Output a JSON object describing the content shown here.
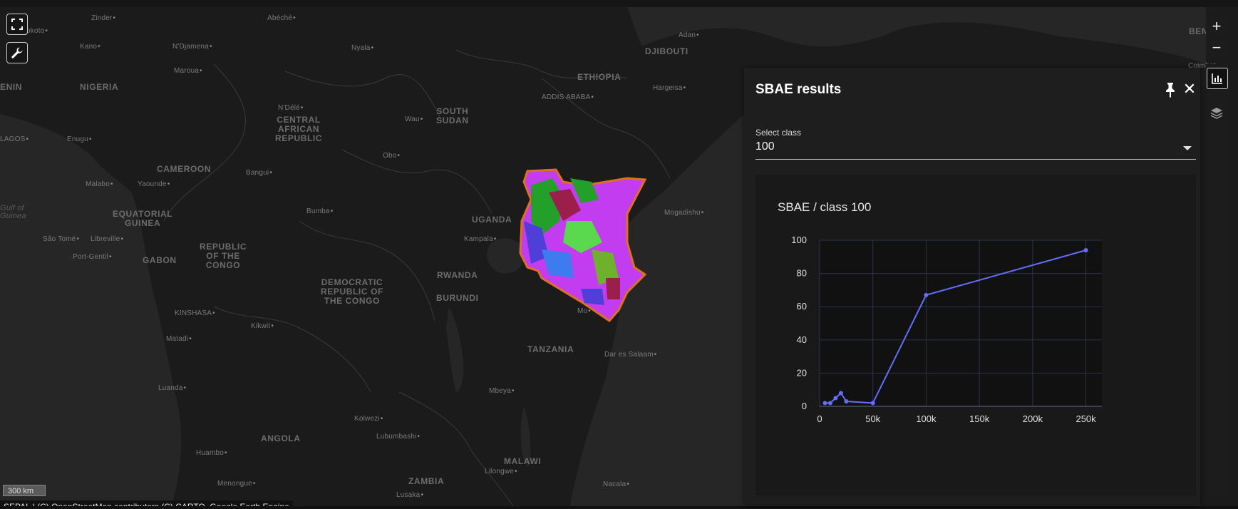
{
  "map": {
    "places": [
      {
        "text": "Zinder",
        "kind": "city"
      },
      {
        "text": "Abéché",
        "kind": "city"
      },
      {
        "text": "Sokoto",
        "kind": "city"
      },
      {
        "text": "Kano",
        "kind": "city"
      },
      {
        "text": "N'Djamena",
        "kind": "city"
      },
      {
        "text": "Nyala",
        "kind": "city"
      },
      {
        "text": "Maroua",
        "kind": "city"
      },
      {
        "text": "NIGERIA",
        "kind": "country"
      },
      {
        "text": "ENIN",
        "kind": "country"
      },
      {
        "text": "N'Délé",
        "kind": "city"
      },
      {
        "text": "CENTRAL\nAFRICAN\nREPUBLIC",
        "kind": "country"
      },
      {
        "text": "SOUTH\nSUDAN",
        "kind": "country"
      },
      {
        "text": "Wau",
        "kind": "city"
      },
      {
        "text": "ETHIOPIA",
        "kind": "country"
      },
      {
        "text": "ADDIS ABABA",
        "kind": "city"
      },
      {
        "text": "DJIBOUTI",
        "kind": "country"
      },
      {
        "text": "Adan",
        "kind": "city"
      },
      {
        "text": "Hargeisa",
        "kind": "city"
      },
      {
        "text": "LAGOS",
        "kind": "city"
      },
      {
        "text": "Enugu",
        "kind": "city"
      },
      {
        "text": "Obo",
        "kind": "city"
      },
      {
        "text": "CAMEROON",
        "kind": "country"
      },
      {
        "text": "Bangui",
        "kind": "city"
      },
      {
        "text": "Malabo",
        "kind": "city"
      },
      {
        "text": "Yaounde",
        "kind": "city"
      },
      {
        "text": "Gulf of\nGuinea",
        "kind": "water"
      },
      {
        "text": "EQUATORIAL\nGUINEA",
        "kind": "country"
      },
      {
        "text": "Bumba",
        "kind": "city"
      },
      {
        "text": "UGANDA",
        "kind": "country"
      },
      {
        "text": "Mogadishu",
        "kind": "city"
      },
      {
        "text": "São Tomé",
        "kind": "city"
      },
      {
        "text": "Libreville",
        "kind": "city"
      },
      {
        "text": "GABON",
        "kind": "country"
      },
      {
        "text": "Port-Gentil",
        "kind": "city"
      },
      {
        "text": "REPUBLIC\nOF THE\nCONGO",
        "kind": "country"
      },
      {
        "text": "Kampala",
        "kind": "city"
      },
      {
        "text": "RWANDA",
        "kind": "country"
      },
      {
        "text": "DEMOCRATIC\nREPUBLIC OF\nTHE CONGO",
        "kind": "country"
      },
      {
        "text": "BURUNDI",
        "kind": "country"
      },
      {
        "text": "KINSHASA",
        "kind": "city"
      },
      {
        "text": "Kikwit",
        "kind": "city"
      },
      {
        "text": "Matadi",
        "kind": "city"
      },
      {
        "text": "TANZANIA",
        "kind": "country"
      },
      {
        "text": "Dar es Salaam",
        "kind": "city"
      },
      {
        "text": "Mo",
        "kind": "city"
      },
      {
        "text": "Luanda",
        "kind": "city"
      },
      {
        "text": "Mbeya",
        "kind": "city"
      },
      {
        "text": "Kolwezi",
        "kind": "city"
      },
      {
        "text": "ANGOLA",
        "kind": "country"
      },
      {
        "text": "Lubumbashi",
        "kind": "city"
      },
      {
        "text": "Huambo",
        "kind": "city"
      },
      {
        "text": "MALAWI",
        "kind": "country"
      },
      {
        "text": "Lilongwe",
        "kind": "city"
      },
      {
        "text": "Menongue",
        "kind": "city"
      },
      {
        "text": "ZAMBIA",
        "kind": "country"
      },
      {
        "text": "Nacala",
        "kind": "city"
      },
      {
        "text": "Lusaka",
        "kind": "city"
      },
      {
        "text": "BENGA",
        "kind": "country"
      },
      {
        "text": "Coimbat",
        "kind": "city"
      }
    ],
    "scale_label": "300 km",
    "attribution": "SEPAL | (C) OpenStreetMap contributors (C) CARTO, Google Earth Engine",
    "overlay_colors": [
      "#c23cf0",
      "#4f3fd8",
      "#22a02a",
      "#5ad94e",
      "#9b1f4a",
      "#3d7cf0",
      "#6fb12d"
    ],
    "overlay_border_color": "#e0701c"
  },
  "controls": {
    "fullscreen_icon": "fullscreen-icon",
    "tools_icon": "wrench-icon",
    "zoom_in": "+",
    "zoom_out": "−",
    "chart_icon": "bar-chart-icon",
    "layers_icon": "layers-icon"
  },
  "panel": {
    "title": "SBAE results",
    "pin_icon": "pin-icon",
    "close_icon": "close-icon",
    "close_glyph": "✕",
    "select_label": "Select class",
    "select_value": "100",
    "accent_color": "#636efa"
  },
  "chart_data": {
    "type": "line",
    "title": "SBAE / class 100",
    "xlabel": "",
    "ylabel": "",
    "x": [
      5000,
      10000,
      15000,
      20000,
      25000,
      50000,
      100000,
      250000
    ],
    "values": [
      2,
      2,
      5,
      8,
      3,
      2,
      67,
      94
    ],
    "xlim": [
      0,
      265000
    ],
    "ylim": [
      0,
      100
    ],
    "x_ticks": [
      0,
      50000,
      100000,
      150000,
      200000,
      250000
    ],
    "x_tick_labels": [
      "0",
      "50k",
      "100k",
      "150k",
      "200k",
      "250k"
    ],
    "y_ticks": [
      0,
      20,
      40,
      60,
      80,
      100
    ],
    "y_tick_labels": [
      "0",
      "20",
      "40",
      "60",
      "80",
      "100"
    ],
    "grid": true,
    "color": "#636efa"
  }
}
